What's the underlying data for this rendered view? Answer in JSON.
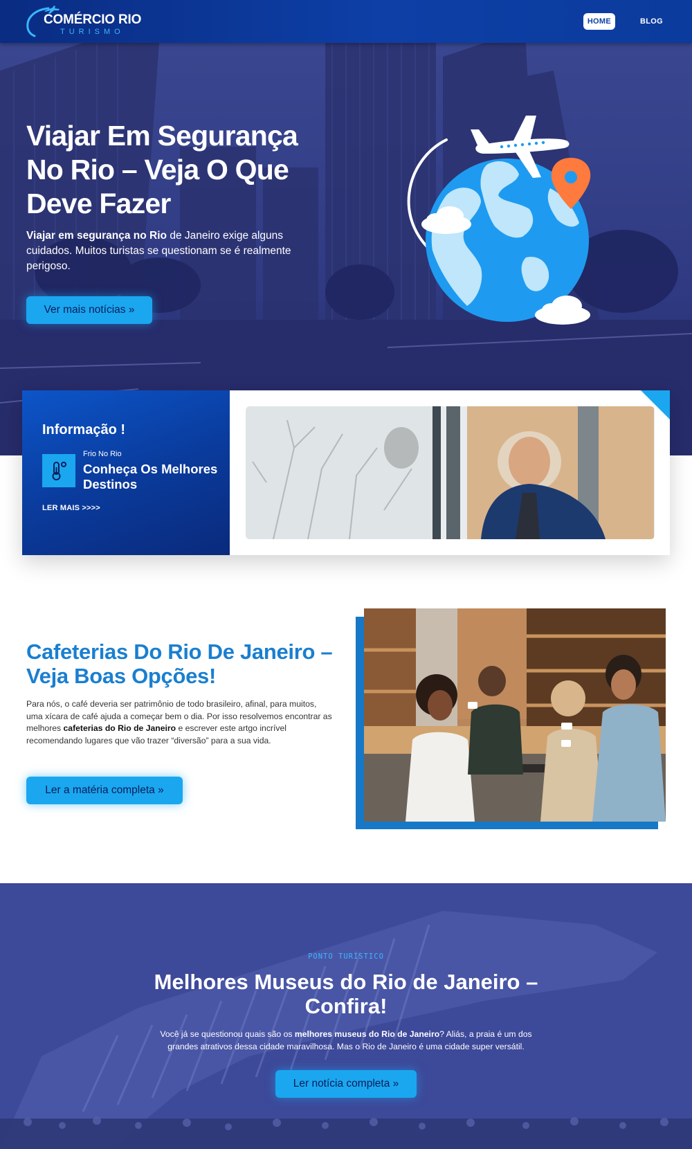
{
  "header": {
    "logo_title": "COMÉRCIO RIO",
    "logo_subtitle": "TURISMO",
    "nav": [
      {
        "label": "HOME",
        "active": true
      },
      {
        "label": "BLOG",
        "active": false
      }
    ]
  },
  "hero": {
    "title": "Viajar Em Segurança No Rio – Veja O Que Deve Fazer",
    "text_bold": "Viajar em segurança no Rio",
    "text_rest": " de Janeiro exige alguns cuidados. Muitos turistas se questionam se é realmente perigoso.",
    "button_label": "Ver mais notícias »"
  },
  "info": {
    "heading": "Informação !",
    "icon": "thermometer-icon",
    "category": "Frio No Rio",
    "title": "Conheça Os Melhores Destinos",
    "more": "LER MAIS >>>>"
  },
  "cafe": {
    "title": "Cafeterias Do Rio De Janeiro – Veja Boas Opções!",
    "text_part1": "Para nós, o café deveria ser patrimônio de todo brasileiro, afinal, para muitos, uma xícara de café ajuda a começar bem o dia. Por isso resolvemos encontrar as melhores ",
    "text_bold": "cafeterias do Rio de Janeiro",
    "text_part2": " e escrever este artgo incrível recomendando lugares que vão trazer “diversão” para a sua vida.",
    "button_label": "Ler a matéria completa »"
  },
  "museum": {
    "tag": "PONTO TURÍSTICO",
    "title": "Melhores Museus do Rio de Janeiro – Confira!",
    "text_part1": "Você já se questionou quais são os ",
    "text_bold": "melhores museus do Rio de Janeiro",
    "text_part2": "? Aliás, a praia é um dos grandes atrativos dessa cidade maravilhosa. Mas o Rio de Janeiro é uma cidade super versátil.",
    "button_label": "Ler notícia completa »"
  },
  "colors": {
    "header_blue": "#0d3fa6",
    "accent_cyan": "#1aa7f0",
    "title_blue": "#1a7fd0",
    "pin_orange": "#ff7a3d"
  }
}
